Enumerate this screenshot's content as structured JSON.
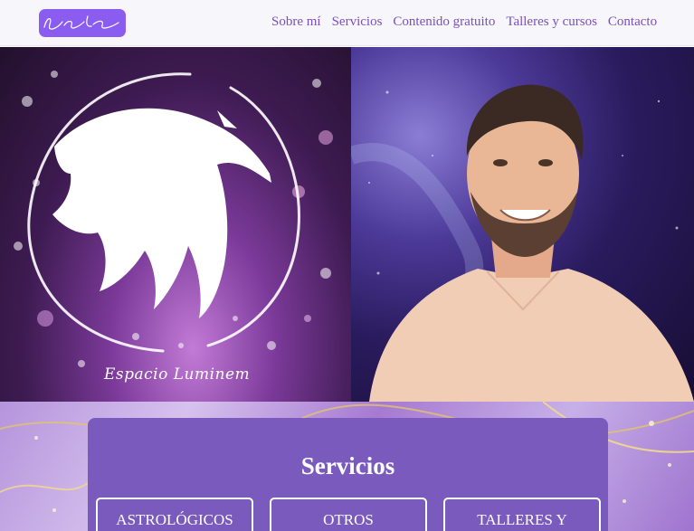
{
  "header": {
    "logo_text": "Espacio Luminem",
    "nav": [
      {
        "label": "Sobre mí"
      },
      {
        "label": "Servicios"
      },
      {
        "label": "Contenido gratuito"
      },
      {
        "label": "Talleres y cursos"
      },
      {
        "label": "Contacto"
      }
    ]
  },
  "hero": {
    "brand_signature": "Espacio Luminem"
  },
  "services": {
    "title": "Servicios",
    "buttons": [
      {
        "label": "ASTROLÓGICOS"
      },
      {
        "label": "OTROS"
      },
      {
        "label": "TALLERES Y"
      }
    ]
  },
  "colors": {
    "accent": "#7b4fbf",
    "logo_bg": "#8a5cf0",
    "card_bg": "#7a5bbd"
  }
}
